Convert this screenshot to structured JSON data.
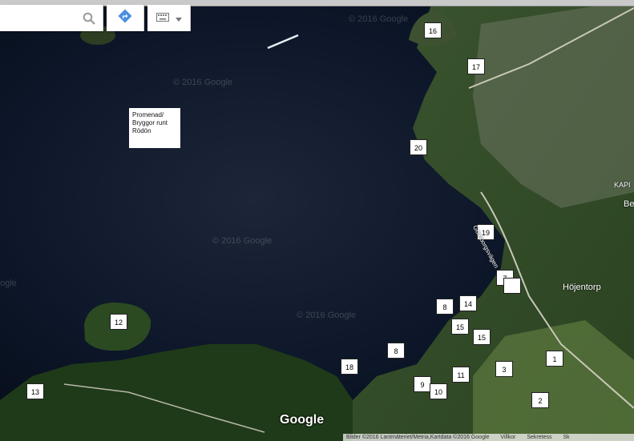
{
  "toolbar": {
    "search_icon": "search-icon",
    "directions_icon": "directions-icon",
    "keyboard_icon": "keyboard-icon",
    "dropdown_icon": "chevron-down-icon"
  },
  "note": {
    "lines": [
      "Promenad/",
      "Bryggor runt",
      "Rödön"
    ]
  },
  "markers": [
    "16",
    "17",
    "20",
    "19",
    "7",
    "",
    "14",
    "8",
    "15",
    "15",
    "12",
    "8",
    "18",
    "11",
    "9",
    "10",
    "3",
    "1",
    "2",
    "13"
  ],
  "watermarks": [
    "© 2016 Google",
    "© 2016 Google",
    "© 2016 Google",
    "© 2016 Google",
    "ogle"
  ],
  "places": {
    "hojentorp": "Höjentorp",
    "kap": "KAPI",
    "be": "Be",
    "road": "Göteborgsvägen"
  },
  "logo": "Google",
  "attribution": {
    "imagery": "Bilder ©2016 Lantmäteriet/Metria,Kartdata ©2016 Google",
    "terms": "Villkor",
    "privacy": "Sekretess",
    "scale": "Sk"
  },
  "colors": {
    "water": "#0a1322",
    "land": "#3a5a2a",
    "marker_bg": "#ffffff",
    "directions_blue": "#4a8fe0"
  }
}
